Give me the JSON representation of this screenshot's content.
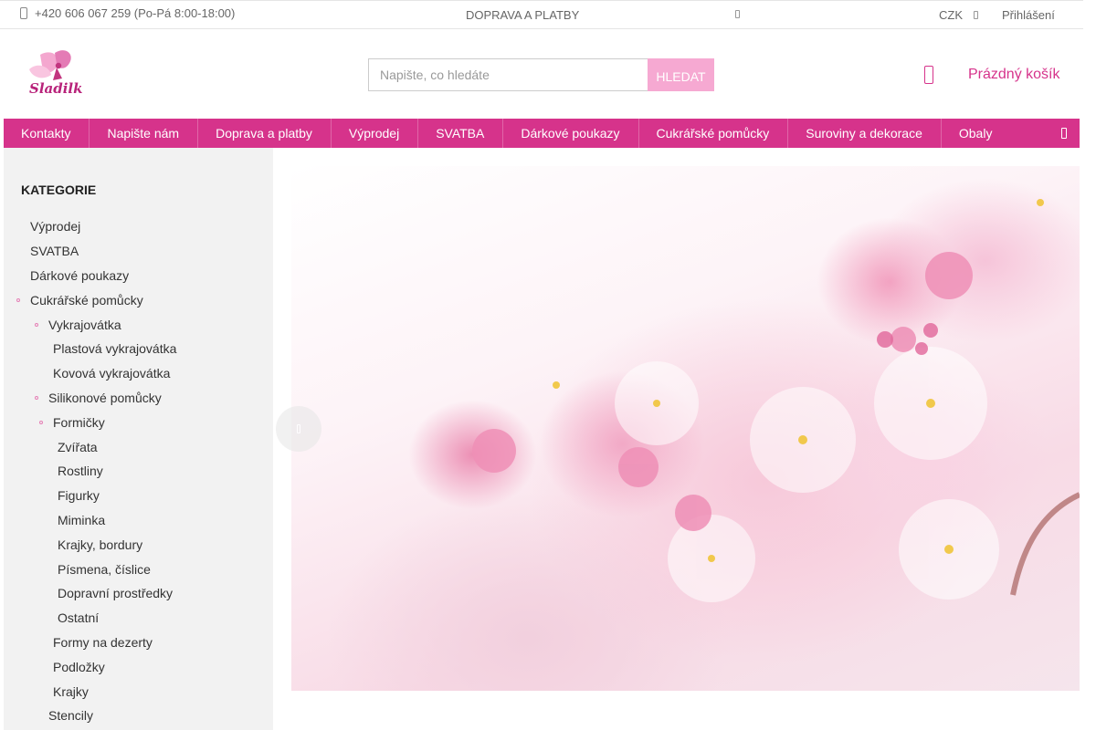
{
  "topbar": {
    "phone": "+420 606 067 259 (Po-Pá 8:00-18:00)",
    "shipping": "DOPRAVA A PLATBY",
    "currency": "CZK",
    "login": "Přihlášení"
  },
  "header": {
    "logo_text": "Sladilka",
    "search_placeholder": "Napište, co hledáte",
    "search_button": "HLEDAT",
    "cart_label": "Prázdný košík"
  },
  "nav": {
    "items": [
      "Kontakty",
      "Napište nám",
      "Doprava a platby",
      "Výprodej",
      "SVATBA",
      "Dárkové poukazy",
      "Cukrářské pomůcky",
      "Suroviny a dekorace",
      "Obaly"
    ]
  },
  "sidebar": {
    "title": "KATEGORIE",
    "categories": [
      {
        "label": "Výprodej"
      },
      {
        "label": "SVATBA"
      },
      {
        "label": "Dárkové poukazy"
      },
      {
        "label": "Cukrářské pomůcky"
      },
      {
        "label": "Vykrajovátka"
      },
      {
        "label": "Plastová vykrajovátka"
      },
      {
        "label": "Kovová vykrajovátka"
      },
      {
        "label": "Silikonové pomůcky"
      },
      {
        "label": "Formičky"
      },
      {
        "label": "Zvířata"
      },
      {
        "label": "Rostliny"
      },
      {
        "label": "Figurky"
      },
      {
        "label": "Miminka"
      },
      {
        "label": "Krajky, bordury"
      },
      {
        "label": "Písmena, číslice"
      },
      {
        "label": "Dopravní prostředky"
      },
      {
        "label": "Ostatní"
      },
      {
        "label": "Formy na dezerty"
      },
      {
        "label": "Podložky"
      },
      {
        "label": "Krajky"
      },
      {
        "label": "Stencily"
      }
    ]
  },
  "colors": {
    "brand": "#d6338b",
    "search_button": "#f6a9d2",
    "sidebar_bg": "#f2f2f2"
  }
}
